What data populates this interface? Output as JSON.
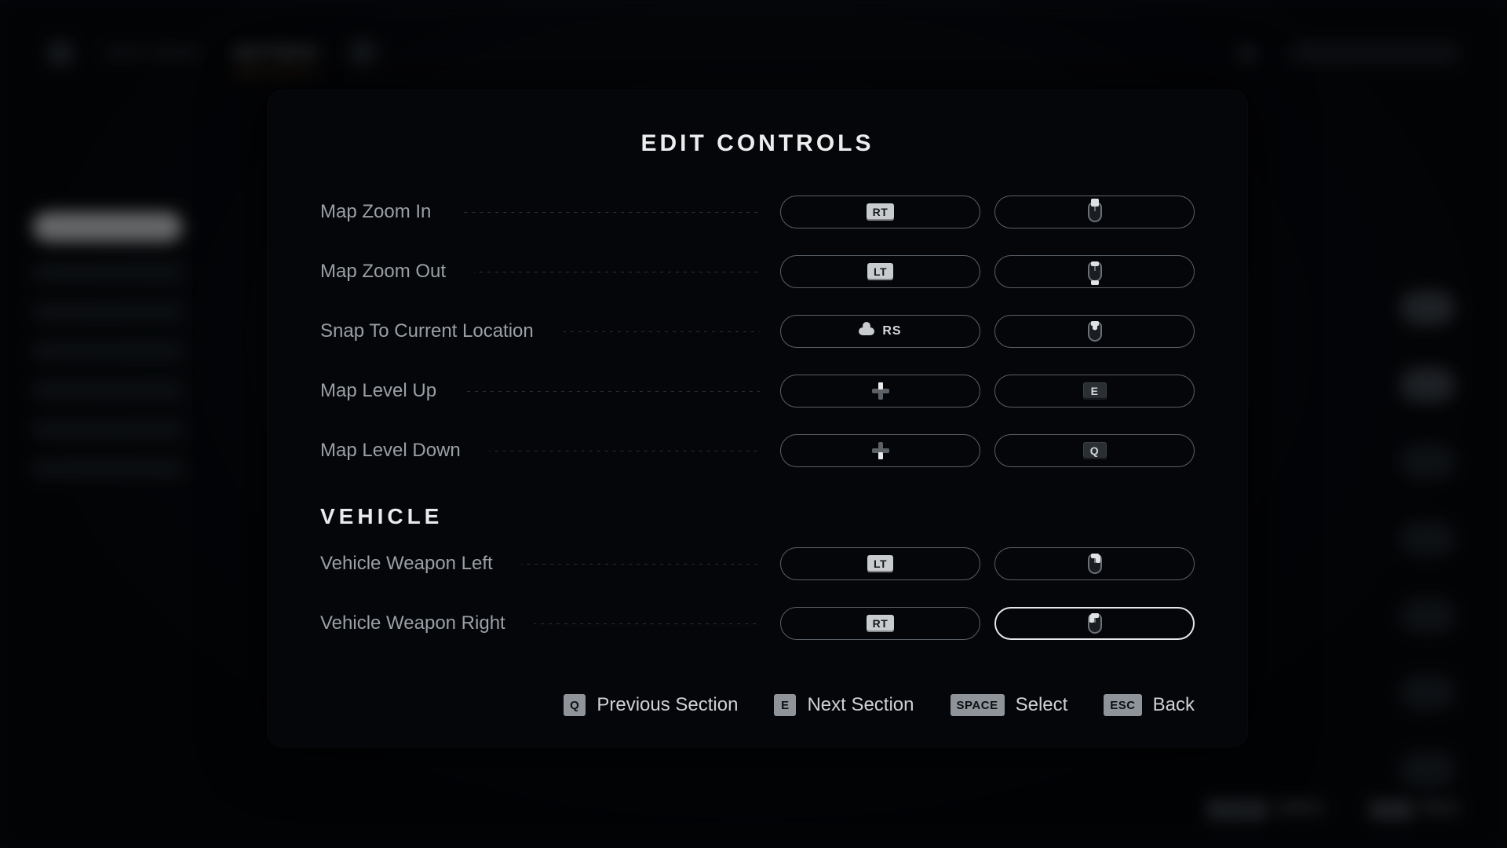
{
  "background": {
    "nav": {
      "prev": "MAIN MENU",
      "active": "SETTINGS"
    },
    "footer": [
      {
        "key": "SPACE",
        "label": "Select"
      },
      {
        "key": "ESC",
        "label": "Back"
      }
    ]
  },
  "modal": {
    "title": "EDIT CONTROLS",
    "sections": [
      {
        "heading": null,
        "rows": [
          {
            "label": "Map Zoom In",
            "primary": {
              "type": "keycap",
              "text": "RT"
            },
            "secondary": {
              "type": "mouse",
              "variant": "wheel-up"
            }
          },
          {
            "label": "Map Zoom Out",
            "primary": {
              "type": "keycap",
              "text": "LT"
            },
            "secondary": {
              "type": "mouse",
              "variant": "wheel-down"
            }
          },
          {
            "label": "Snap To Current Location",
            "primary": {
              "type": "rs",
              "text": "RS"
            },
            "secondary": {
              "type": "mouse",
              "variant": "middle"
            }
          },
          {
            "label": "Map Level Up",
            "primary": {
              "type": "dpad",
              "variant": "up"
            },
            "secondary": {
              "type": "keycap-dark",
              "text": "E"
            }
          },
          {
            "label": "Map Level Down",
            "primary": {
              "type": "dpad",
              "variant": "down"
            },
            "secondary": {
              "type": "keycap-dark",
              "text": "Q"
            }
          }
        ]
      },
      {
        "heading": "VEHICLE",
        "rows": [
          {
            "label": "Vehicle Weapon Left",
            "primary": {
              "type": "keycap",
              "text": "LT"
            },
            "secondary": {
              "type": "mouse",
              "variant": "right"
            }
          },
          {
            "label": "Vehicle Weapon Right",
            "primary": {
              "type": "keycap",
              "text": "RT"
            },
            "secondary": {
              "type": "mouse",
              "variant": "left",
              "selected": true
            }
          }
        ]
      }
    ],
    "footer": [
      {
        "key": "Q",
        "label": "Previous Section"
      },
      {
        "key": "E",
        "label": "Next Section"
      },
      {
        "key": "SPACE",
        "label": "Select"
      },
      {
        "key": "ESC",
        "label": "Back"
      }
    ]
  }
}
